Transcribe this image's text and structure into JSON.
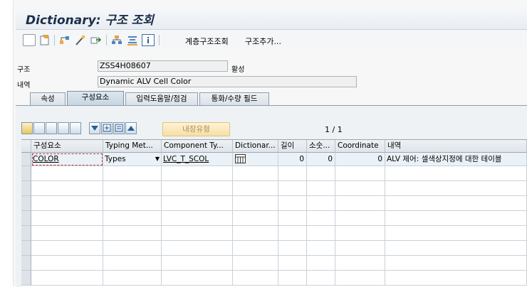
{
  "title": "Dictionary: 구조 조회",
  "toolbar": {
    "icons": [
      "new-page-icon",
      "display-change-icon",
      "hierarchy-icon",
      "magic-wand-icon",
      "transport-icon",
      "where-used-icon",
      "structure-icon",
      "info-icon"
    ],
    "buttons": [
      "계층구조조회",
      "구조추가..."
    ]
  },
  "header": {
    "structure_label": "구조",
    "structure_value": "ZSS4H08607",
    "status": "활성",
    "desc_label": "내역",
    "desc_value": "Dynamic ALV Cell Color"
  },
  "tabs": [
    "속성",
    "구성요소",
    "입력도움말/점검",
    "통화/수량 필드"
  ],
  "active_tab": 1,
  "grid_toolbar": {
    "builtin_type_button": "내장유형",
    "pager": "1 / 1"
  },
  "table": {
    "columns": [
      "구성요소",
      "Typing Met...",
      "Component Ty...",
      "Dictionar...",
      "길이",
      "소숫...",
      "Coordinate",
      "내역"
    ],
    "rows": [
      {
        "component": "COLOR",
        "typing": "Types",
        "component_type": "LVC_T_SCOL",
        "length": "0",
        "decimals": "0",
        "coordinate": "0",
        "description": "ALV 제어: 셀색상지정에 대한 테이블"
      }
    ]
  },
  "colors": {
    "title": "#1b2f4a",
    "active_tab": "#c6d6e3",
    "disabled_button": "#f6dfa7",
    "selected_row": "#eaf1f7"
  }
}
